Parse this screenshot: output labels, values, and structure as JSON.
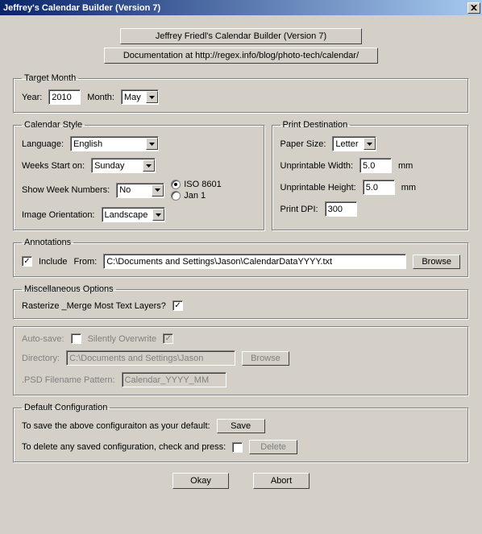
{
  "title": "Jeffrey's Calendar Builder (Version 7)",
  "header": {
    "main_button": "Jeffrey Friedl's Calendar Builder (Version 7)",
    "doc_button": "Documentation at http://regex.info/blog/photo-tech/calendar/"
  },
  "target_month": {
    "legend": "Target Month",
    "year_label": "Year:",
    "year_value": "2010",
    "month_label": "Month:",
    "month_value": "May"
  },
  "calendar_style": {
    "legend": "Calendar Style",
    "language_label": "Language:",
    "language_value": "English",
    "weeks_start_label": "Weeks Start on:",
    "weeks_start_value": "Sunday",
    "show_week_label": "Show Week Numbers:",
    "show_week_value": "No",
    "iso_label": "ISO 8601",
    "jan1_label": "Jan 1",
    "orientation_label": "Image Orientation:",
    "orientation_value": "Landscape"
  },
  "print_dest": {
    "legend": "Print Destination",
    "paper_label": "Paper Size:",
    "paper_value": "Letter",
    "uw_label": "Unprintable Width:",
    "uw_value": "5.0",
    "uh_label": "Unprintable Height:",
    "uh_value": "5.0",
    "mm": "mm",
    "dpi_label": "Print DPI:",
    "dpi_value": "300"
  },
  "annotations": {
    "legend": "Annotations",
    "include_label": "Include",
    "from_label": "From:",
    "path": "C:\\Documents and Settings\\Jason\\CalendarDataYYYY.txt",
    "browse": "Browse"
  },
  "misc": {
    "legend": "Miscellaneous Options",
    "rasterize_label": "Rasterize _Merge Most Text Layers?"
  },
  "autosave": {
    "auto_label": "Auto-save:",
    "silent_label": "Silently Overwrite",
    "dir_label": "Directory:",
    "dir_value": "C:\\Documents and Settings\\Jason",
    "browse": "Browse",
    "pattern_label": ".PSD Filename Pattern:",
    "pattern_value": "Calendar_YYYY_MM"
  },
  "default_config": {
    "legend": "Default Configuration",
    "save_text": "To save the above configuraiton as your default:",
    "save_btn": "Save",
    "delete_text": "To delete any saved configuration, check and press:",
    "delete_btn": "Delete"
  },
  "footer": {
    "okay": "Okay",
    "abort": "Abort"
  }
}
